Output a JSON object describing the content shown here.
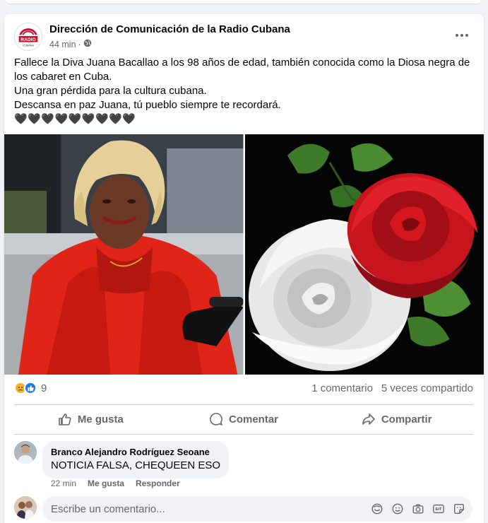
{
  "post": {
    "page_name": "Dirección de Comunicación de la Radio Cubana",
    "time": "44 min",
    "dot": "·",
    "avatar_text": "RADIO",
    "avatar_subtext": "CUBANA",
    "text_lines": [
      "Fallece la Diva Juana Bacallao a los 98 años de edad, también conocida como la Diosa negra de los cabaret en Cuba.",
      "Una gran pérdida para la cultura cubana.",
      "Descansa en paz Juana, tú pueblo siempre te recordará."
    ],
    "hearts": "🖤🖤🖤🖤🖤🖤🖤🖤🖤"
  },
  "stats": {
    "reaction_count": "9",
    "comments": "1 comentario",
    "shares": "5 veces compartido",
    "reaction_icons": [
      "sad-reaction-icon",
      "like-reaction-icon"
    ]
  },
  "actions": {
    "like": "Me gusta",
    "comment": "Comentar",
    "share": "Compartir"
  },
  "comment": {
    "author": "Branco Alejandro Rodríguez Seoane",
    "text": "NOTICIA FALSA, CHEQUEEN ESO",
    "time": "22 min",
    "like": "Me gusta",
    "reply": "Responder"
  },
  "composer": {
    "placeholder": "Escribe un comentario..."
  },
  "colors": {
    "accent": "#1877f2",
    "brand_red": "#c8102e",
    "secondary_text": "#65676b"
  }
}
